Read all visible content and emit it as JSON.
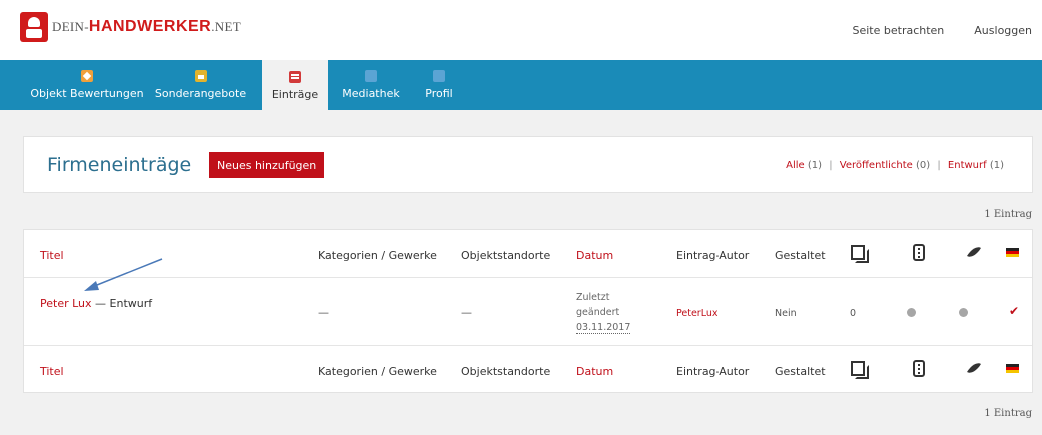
{
  "topbar": {
    "logo": {
      "part_a": "DEIN-",
      "part_b": "HANDWERKER",
      "part_c": ".NET"
    },
    "links": [
      "Seite betrachten",
      "Ausloggen"
    ]
  },
  "nav": {
    "items": [
      {
        "label": "Objekt Bewertungen",
        "icon": "star-icon",
        "color": "#f0a03c"
      },
      {
        "label": "Sonderangebote",
        "icon": "offer-icon",
        "color": "#e2b32d"
      },
      {
        "label": "Einträge",
        "icon": "list-icon",
        "color": "#d23a3a",
        "active": true
      },
      {
        "label": "Mediathek",
        "icon": "media-icon",
        "color": "#5ba4d4"
      },
      {
        "label": "Profil",
        "icon": "profile-icon",
        "color": "#5ba4d4"
      }
    ],
    "bg_color": "#1a8bb8"
  },
  "header": {
    "title": "Firmeneinträge",
    "add_button": "Neues hinzufügen",
    "filters": [
      {
        "label": "Alle",
        "count": "(1)"
      },
      {
        "label": "Veröffentlichte",
        "count": "(0)"
      },
      {
        "label": "Entwurf",
        "count": "(1)"
      }
    ],
    "separator": "|"
  },
  "count_label": "1 Eintrag",
  "table": {
    "columns": {
      "title": "Titel",
      "categories": "Kategorien / Gewerke",
      "locations": "Objektstandorte",
      "date": "Datum",
      "author": "Eintrag-Autor",
      "designed": "Gestaltet",
      "icon_columns": [
        "copy-icon",
        "phone-icon",
        "feather-icon",
        "flag-de-icon"
      ]
    },
    "rows": [
      {
        "title": "Peter Lux",
        "state": " — Entwurf",
        "categories": "—",
        "locations": "—",
        "date_line1": "Zuletzt",
        "date_line2": "geändert",
        "date_line3": "03.11.2017",
        "author": "PeterLux",
        "designed": "Nein",
        "copies": "0",
        "status_icon": "check-icon"
      }
    ]
  },
  "accent_color": "#c0101a"
}
